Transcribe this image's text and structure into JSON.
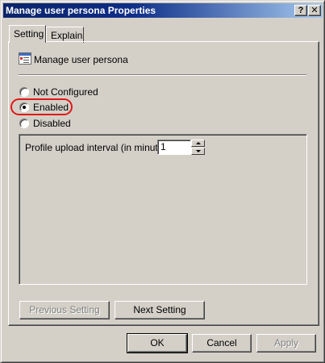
{
  "window": {
    "title": "Manage user persona Properties",
    "help_button": "?",
    "close_button": "✕",
    "active_title_color": "#0a246a"
  },
  "tabs": [
    {
      "label": "Setting",
      "selected": true
    },
    {
      "label": "Explain",
      "selected": false
    }
  ],
  "policy": {
    "icon": "policy-document-icon",
    "name": "Manage user persona"
  },
  "state_options": [
    {
      "label": "Not Configured",
      "selected": false
    },
    {
      "label": "Enabled",
      "selected": true
    },
    {
      "label": "Disabled",
      "selected": false
    }
  ],
  "highlight_color": "#e01818",
  "options": {
    "profile_upload_interval_label": "Profile upload interval (in minutes):",
    "profile_upload_interval_value": "1"
  },
  "nav_buttons": {
    "previous": "Previous Setting",
    "next": "Next Setting"
  },
  "dialog_buttons": {
    "ok": "OK",
    "cancel": "Cancel",
    "apply": "Apply"
  }
}
